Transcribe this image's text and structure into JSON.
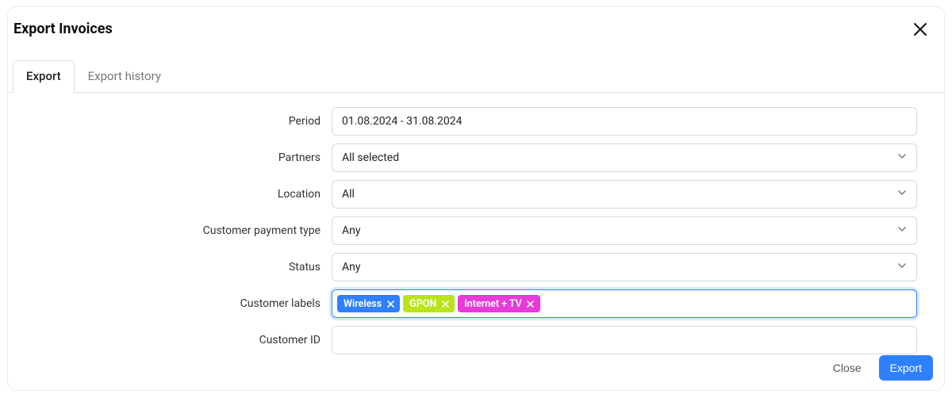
{
  "title": "Export Invoices",
  "tabs": {
    "export": "Export",
    "history": "Export history"
  },
  "form": {
    "period": {
      "label": "Period",
      "value": "01.08.2024 - 31.08.2024"
    },
    "partners": {
      "label": "Partners",
      "value": "All selected"
    },
    "location": {
      "label": "Location",
      "value": "All"
    },
    "payment_type": {
      "label": "Customer payment type",
      "value": "Any"
    },
    "status": {
      "label": "Status",
      "value": "Any"
    },
    "labels": {
      "label": "Customer labels",
      "tags": [
        {
          "text": "Wireless",
          "color": "#2f80ff"
        },
        {
          "text": "GPON",
          "color": "#b9e41a"
        },
        {
          "text": "Internet + TV",
          "color": "#e83ad9"
        }
      ]
    },
    "customer_id": {
      "label": "Customer ID",
      "value": ""
    }
  },
  "footer": {
    "close": "Close",
    "export": "Export"
  }
}
